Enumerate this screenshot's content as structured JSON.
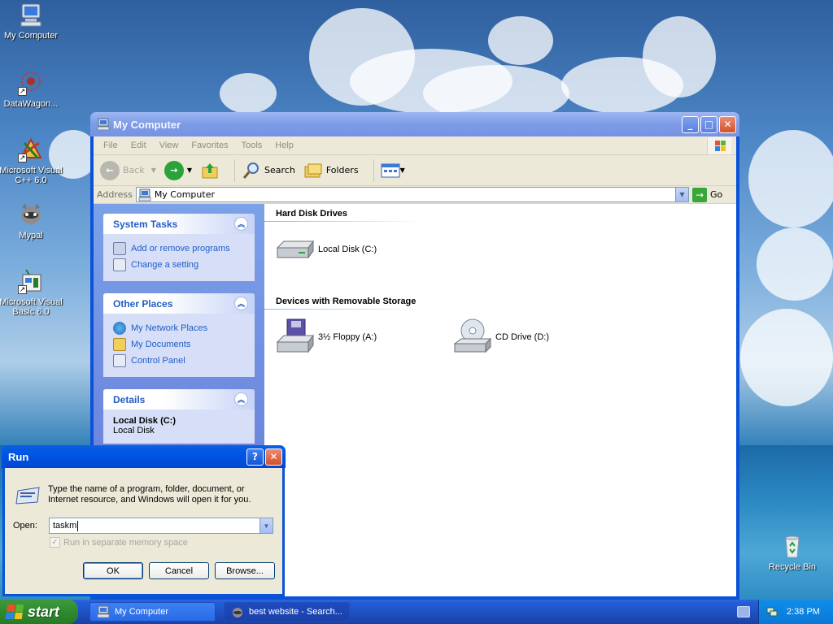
{
  "desktop": {
    "icons": [
      {
        "label": "My Computer"
      },
      {
        "label": "DataWagon..."
      },
      {
        "label": "Microsoft Visual C++ 6.0"
      },
      {
        "label": "Mypal"
      },
      {
        "label": "Microsoft Visual Basic 6.0"
      },
      {
        "label": "Recycle Bin"
      }
    ]
  },
  "explorer": {
    "title": "My Computer",
    "menu": [
      "File",
      "Edit",
      "View",
      "Favorites",
      "Tools",
      "Help"
    ],
    "toolbar": {
      "back": "Back",
      "search": "Search",
      "folders": "Folders"
    },
    "address": {
      "label": "Address",
      "value": "My Computer",
      "go": "Go"
    },
    "tasks": {
      "system_title": "System Tasks",
      "system_items": [
        "Add or remove programs",
        "Change a setting"
      ],
      "other_title": "Other Places",
      "other_items": [
        "My Network Places",
        "My Documents",
        "Control Panel"
      ],
      "details_title": "Details",
      "details_name": "Local Disk (C:)",
      "details_type": "Local Disk"
    },
    "groups": {
      "hdd_title": "Hard Disk Drives",
      "hdd_items": [
        "Local Disk (C:)"
      ],
      "removable_title": "Devices with Removable Storage",
      "removable_items": [
        "3½ Floppy (A:)",
        "CD Drive (D:)"
      ]
    }
  },
  "run_dialog": {
    "title": "Run",
    "description": "Type the name of a program, folder, document, or Internet resource, and Windows will open it for you.",
    "open_label": "Open:",
    "open_value": "taskm",
    "checkbox_label": "Run in separate memory space",
    "ok": "OK",
    "cancel": "Cancel",
    "browse": "Browse..."
  },
  "taskbar": {
    "start": "start",
    "tasks": [
      "My Computer",
      "best website - Search..."
    ],
    "clock": "2:38 PM"
  },
  "colors": {
    "title_active": "#0a53d8",
    "link_blue": "#215dc6",
    "start_green": "#2f8a2f"
  }
}
